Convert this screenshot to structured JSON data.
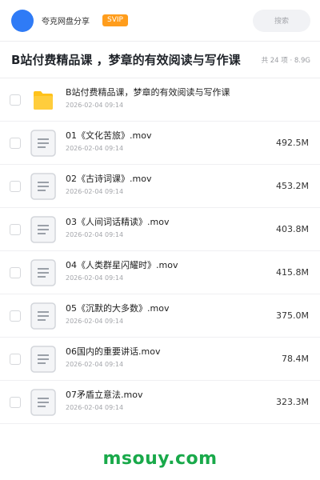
{
  "header": {
    "user_name": "夸克网盘分享",
    "badge": "SVIP",
    "search_placeholder": "搜索",
    "avatar_color": "#2f7bf6"
  },
  "folder": {
    "title": "B站付费精品课 ，梦章的有效阅读与写作课",
    "meta": "共 24 项 · 8.9G"
  },
  "items": [
    {
      "type": "folder",
      "name": "B站付费精品课，梦章的有效阅读与写作课",
      "date": "2026-02-04 09:14",
      "size": "",
      "icon": "folder-icon"
    },
    {
      "type": "file",
      "name": "01《文化苦旅》.mov",
      "date": "2026-02-04 09:14",
      "size": "492.5M",
      "icon": "document-icon"
    },
    {
      "type": "file",
      "name": "02《古诗词课》.mov",
      "date": "2026-02-04 09:14",
      "size": "453.2M",
      "icon": "document-icon"
    },
    {
      "type": "file",
      "name": "03《人间词话精读》.mov",
      "date": "2026-02-04 09:14",
      "size": "403.8M",
      "icon": "document-icon"
    },
    {
      "type": "file",
      "name": "04《人类群星闪耀时》.mov",
      "date": "2026-02-04 09:14",
      "size": "415.8M",
      "icon": "document-icon"
    },
    {
      "type": "file",
      "name": "05《沉默的大多数》.mov",
      "date": "2026-02-04 09:14",
      "size": "375.0M",
      "icon": "document-icon"
    },
    {
      "type": "file",
      "name": "06国内的重要讲话.mov",
      "date": "2026-02-04 09:14",
      "size": "78.4M",
      "icon": "document-icon"
    },
    {
      "type": "file",
      "name": "07矛盾立意法.mov",
      "date": "2026-02-04 09:14",
      "size": "323.3M",
      "icon": "document-icon"
    }
  ],
  "watermark": "msouy.com",
  "colors": {
    "accent": "#2f7bf6",
    "svip": "#ff9d1c",
    "folder": "#ffc21a",
    "watermark": "#19a94a"
  }
}
